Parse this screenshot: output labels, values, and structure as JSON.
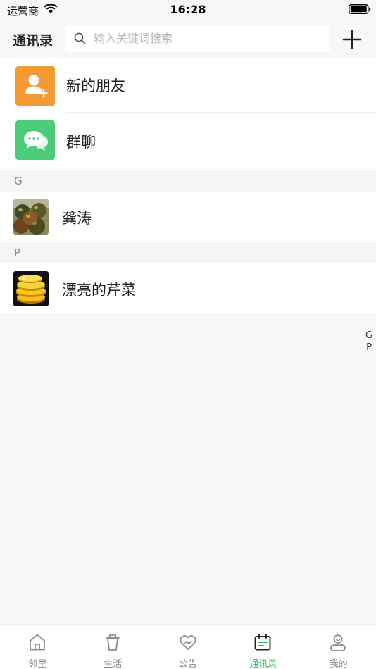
{
  "status_bar": {
    "carrier": "运营商",
    "time": "16:28"
  },
  "header": {
    "title": "通讯录",
    "search_placeholder": "输入关键词搜索",
    "search_value": ""
  },
  "entries": {
    "new_friends": {
      "label": "新的朋友",
      "color": "#f49a35"
    },
    "group_chat": {
      "label": "群聊",
      "color": "#4ccb78"
    }
  },
  "sections": [
    {
      "letter": "G",
      "contacts": [
        {
          "name": "龚涛",
          "avatar": "tomato-photo"
        }
      ]
    },
    {
      "letter": "P",
      "contacts": [
        {
          "name": "漂亮的芹菜",
          "avatar": "gold-coins-photo"
        }
      ]
    }
  ],
  "index_letters": [
    "G",
    "P"
  ],
  "tabs": [
    {
      "label": "邻里",
      "icon": "home-icon",
      "active": false
    },
    {
      "label": "生活",
      "icon": "cup-icon",
      "active": false
    },
    {
      "label": "公告",
      "icon": "heart-icon",
      "active": false
    },
    {
      "label": "通讯录",
      "icon": "calendar-contacts-icon",
      "active": true
    },
    {
      "label": "我的",
      "icon": "user-icon",
      "active": false
    }
  ],
  "colors": {
    "accent": "#2ebd59",
    "inactive": "#8a8a8a"
  }
}
